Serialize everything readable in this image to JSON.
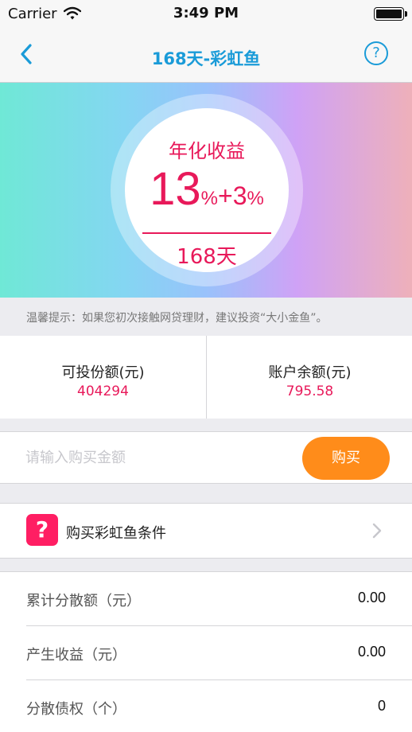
{
  "status_bar": {
    "carrier": "Carrier",
    "time": "3:49 PM"
  },
  "nav": {
    "title": "168天-彩虹鱼",
    "help_label": "?"
  },
  "banner": {
    "label": "年化收益",
    "rate_main": "13",
    "rate_unit": "%",
    "rate_extra": "+3",
    "rate_extra_unit": "%",
    "term": "168天"
  },
  "tip": "温馨提示：如果您初次接触网贷理财，建议投资“大小金鱼”。",
  "amounts": {
    "investable": {
      "label": "可投份额(元)",
      "value": "404294"
    },
    "balance": {
      "label": "账户余额(元)",
      "value": "795.58"
    }
  },
  "buy": {
    "placeholder": "请输入购买金额",
    "button": "购买"
  },
  "condition": {
    "icon": "?",
    "label": "购买彩虹鱼条件"
  },
  "stats": [
    {
      "label": "累计分散额（元）",
      "value": "0.00"
    },
    {
      "label": "产生收益（元）",
      "value": "0.00"
    },
    {
      "label": "分散债权（个）",
      "value": "0"
    }
  ],
  "colors": {
    "accent": "#1a9bd8",
    "highlight": "#e8195a",
    "buy_button": "#ff8c1a",
    "condition_icon": "#ff1e63"
  }
}
